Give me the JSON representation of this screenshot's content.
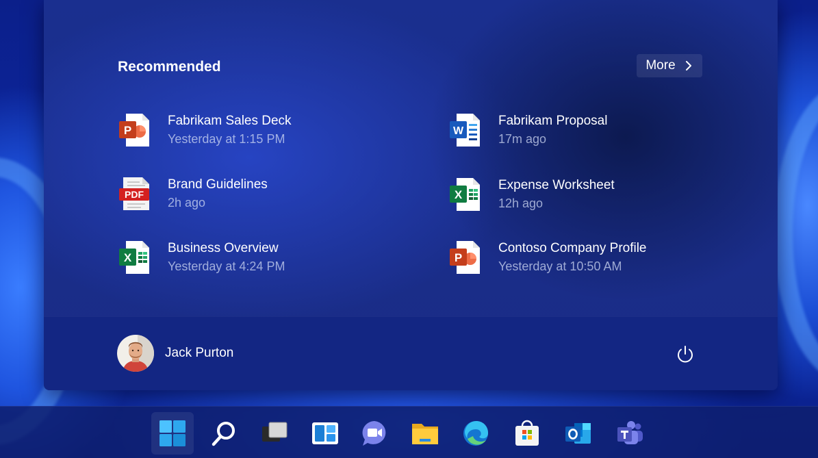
{
  "start_menu": {
    "recommended_title": "Recommended",
    "more_label": "More",
    "recommended": [
      {
        "name": "Fabrikam Sales Deck",
        "time": "Yesterday at 1:15 PM",
        "icon": "powerpoint-icon"
      },
      {
        "name": "Fabrikam Proposal",
        "time": "17m ago",
        "icon": "word-icon"
      },
      {
        "name": "Brand Guidelines",
        "time": "2h ago",
        "icon": "pdf-icon"
      },
      {
        "name": "Expense Worksheet",
        "time": "12h ago",
        "icon": "excel-icon"
      },
      {
        "name": "Business Overview",
        "time": "Yesterday at 4:24 PM",
        "icon": "excel-icon"
      },
      {
        "name": "Contoso Company Profile",
        "time": "Yesterday at 10:50 AM",
        "icon": "powerpoint-icon"
      }
    ],
    "user": {
      "name": "Jack Purton"
    },
    "pdf_badge": "PDF"
  },
  "taskbar": {
    "items": [
      "start-icon",
      "search-icon",
      "task-view-icon",
      "widgets-icon",
      "chat-icon",
      "file-explorer-icon",
      "edge-icon",
      "store-icon",
      "outlook-icon",
      "teams-icon"
    ]
  },
  "colors": {
    "powerpoint": "#c43e1c",
    "word": "#185abd",
    "excel": "#107c41",
    "pdf": "#d42020",
    "accent": "#4cc2ff"
  }
}
